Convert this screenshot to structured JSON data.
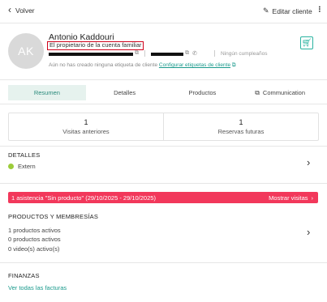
{
  "topbar": {
    "back_label": "Volver",
    "edit_label": "Editar cliente"
  },
  "customer": {
    "initials": "AK",
    "name": "Antonio Kaddouri",
    "family_owner_label": "El propietario de la cuenta familiar",
    "birthday_label": "Ningún cumpleaños",
    "no_tags_text": "Aún no has creado ninguna etiqueta de cliente",
    "configure_tags_link": "Configurar etiquetas de cliente"
  },
  "tabs": [
    {
      "label": "Resumen",
      "active": true
    },
    {
      "label": "Detalles",
      "active": false
    },
    {
      "label": "Productos",
      "active": false
    },
    {
      "label": "Communication",
      "active": false
    }
  ],
  "stats": [
    {
      "value": "1",
      "label": "Visitas anteriores"
    },
    {
      "value": "1",
      "label": "Reservas futuras"
    }
  ],
  "details": {
    "title": "DETALLES",
    "status": "Extern",
    "status_color": "#9ccc3a"
  },
  "alert": {
    "text": "1 asistencia \"Sin producto\" (29/10/2025 - 29/10/2025)",
    "action": "Mostrar visitas",
    "color": "#f2385b"
  },
  "products": {
    "title": "PRODUCTOS Y MEMBRESÍAS",
    "lines": [
      "1 productos activos",
      "0 productos activos",
      "0 video(s) activo(s)"
    ]
  },
  "finances": {
    "title": "FINANZAS",
    "link": "Ver todas las facturas"
  },
  "colors": {
    "accent": "#2ab3a0",
    "link": "#1a9a8c",
    "active_tab_bg": "#e6f2ee"
  },
  "icons": {
    "back": "chevron-left-icon",
    "edit": "pencil-icon",
    "more": "kebab-icon",
    "cart": "cart-icon",
    "copy": "copy-icon",
    "phone": "phone-icon",
    "external": "external-link-icon",
    "next": "chevron-right-icon"
  }
}
